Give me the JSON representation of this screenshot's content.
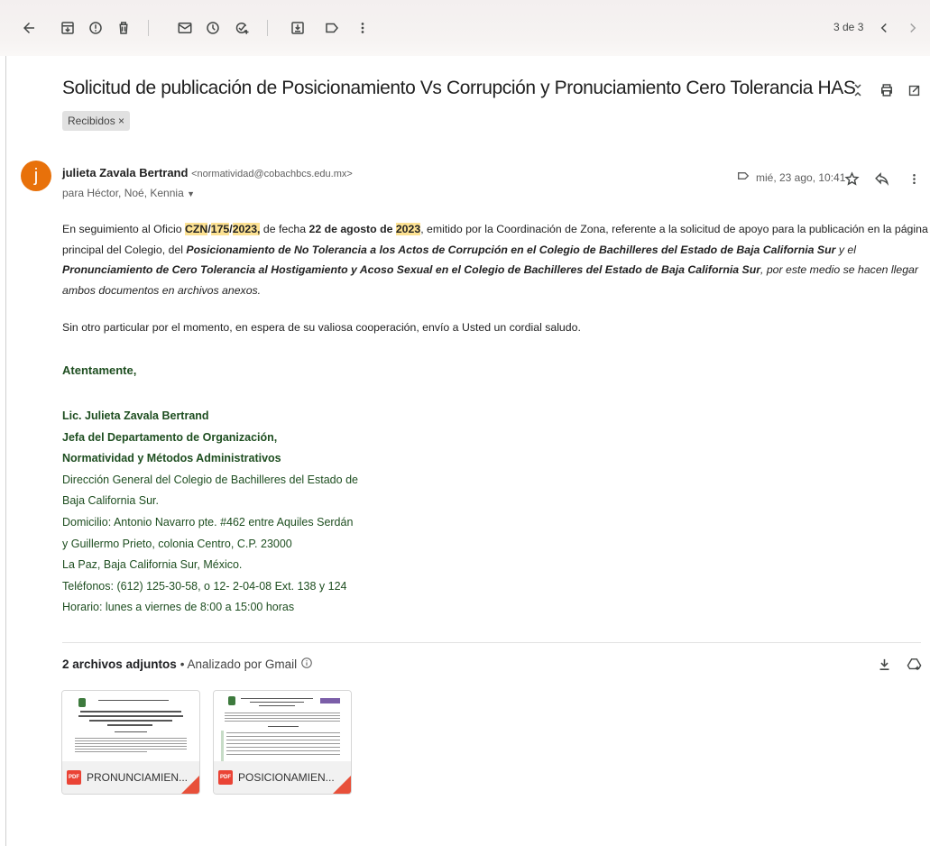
{
  "toolbar": {
    "icons": [
      "back-arrow-icon",
      "archive-icon",
      "report-spam-icon",
      "delete-icon",
      "mark-unread-icon",
      "snooze-icon",
      "add-to-tasks-icon",
      "move-to-icon",
      "labels-icon",
      "more-vert-icon"
    ],
    "pager_text": "3 de 3"
  },
  "email": {
    "subject": "Solicitud de publicación de Posicionamiento Vs Corrupción y Pronuciamiento Cero Tolerancia HAS",
    "label_chip": "Recibidos ×",
    "sender_initial": "j",
    "avatar_color": "#e8710a",
    "sender_name": "julieta Zavala Bertrand",
    "sender_email": "<normatividad@cobachbcs.edu.mx>",
    "recipients": "para Héctor, Noé, Kennia",
    "date": "mié, 23 ago, 10:41"
  },
  "body": {
    "p1": {
      "a": "En seguimiento al Oficio ",
      "czn": "CZN",
      "slash1": "/",
      "num": "175",
      "slash2": "/",
      "year": "2023,",
      "b": " de fecha ",
      "fecha": "22 de agosto de ",
      "year2": "2023",
      "c": ", emitido por la Coordinación de Zona, referente a la solicitud de apoyo para la publicación en la página principal del Colegio, del ",
      "d": "Posicionamiento de No Tolerancia a los Actos de Corrupción en el Colegio de Bachilleres del Estado de Baja California Sur",
      "e": " y el ",
      "f": "Pronunciamiento de Cero Tolerancia al Hostigamiento y Acoso Sexual en el Colegio de Bachilleres del Estado de Baja California Sur",
      "g": ", por este medio se hacen llegar ambos documentos en archivos anexos."
    },
    "p2": "Sin otro particular por el momento, en espera de su valiosa cooperación, envío a Usted un cordial saludo.",
    "closing": "Atentamente,"
  },
  "signature": {
    "name": "Lic. Julieta Zavala Bertrand",
    "title1": "Jefa del Departamento de Organización,",
    "title2": "Normatividad y Métodos Administrativos",
    "org1": "Dirección General del Colegio de Bachilleres del Estado de",
    "org2": "Baja California Sur.",
    "addr1": "Domicilio: Antonio Navarro pte. #462 entre Aquiles Serdán",
    "addr2": "y Guillermo Prieto, colonia Centro, C.P. 23000",
    "city": "La Paz, Baja California Sur, México.",
    "phones": "Teléfonos: (612) 125-30-58, o 12- 2-04-08 Ext. 138 y 124",
    "hours": "Horario: lunes a viernes de 8:00 a 15:00 horas"
  },
  "attachments": {
    "heading": "2 archivos adjuntos",
    "scanned": "• Analizado por Gmail",
    "files": [
      {
        "name": "PRONUNCIAMIEN...",
        "type": "PDF"
      },
      {
        "name": "POSICIONAMIEN...",
        "type": "PDF"
      }
    ]
  }
}
